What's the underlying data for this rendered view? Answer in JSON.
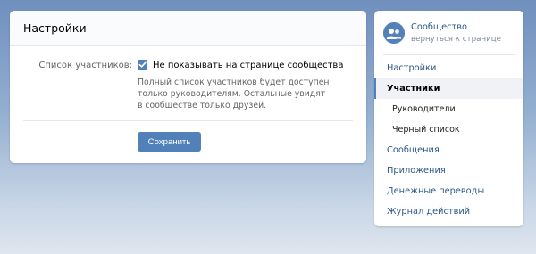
{
  "settings": {
    "title": "Настройки",
    "members_label": "Список участников:",
    "hide_checkbox_label": "Не показывать на странице сообщества",
    "hide_checkbox_checked": true,
    "hint_line1": "Полный список участников будет доступен",
    "hint_line2": "только руководителям. Остальные увидят",
    "hint_line3": "в сообществе только друзей.",
    "save_label": "Сохранить"
  },
  "nav": {
    "community_name": "Сообщество",
    "back_link": "вернуться к странице",
    "items": [
      {
        "label": "Настройки"
      },
      {
        "label": "Участники"
      },
      {
        "label": "Руководители"
      },
      {
        "label": "Черный список"
      },
      {
        "label": "Сообщения"
      },
      {
        "label": "Приложения"
      },
      {
        "label": "Денежные переводы"
      },
      {
        "label": "Журнал действий"
      }
    ]
  },
  "colors": {
    "accent": "#5181b8",
    "link": "#2a5885"
  },
  "icons": {
    "checkbox": "check-icon",
    "avatar": "community-avatar-icon"
  }
}
